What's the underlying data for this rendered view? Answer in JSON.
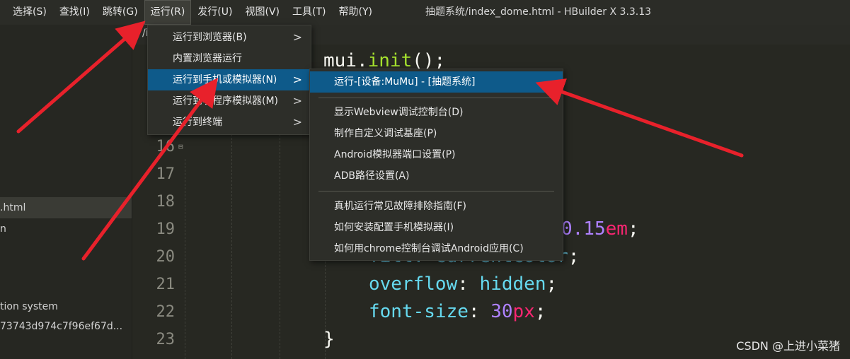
{
  "menubar": {
    "items": [
      "选择(S)",
      "查找(I)",
      "跳转(G)",
      "运行(R)",
      "发行(U)",
      "视图(V)",
      "工具(T)",
      "帮助(Y)"
    ],
    "title": "抽题系统/index_dome.html - HBuilder X 3.3.13"
  },
  "sidebar": {
    "files": [
      ".html",
      "n",
      "tion system",
      "73743d974c7f96ef67d..."
    ]
  },
  "editor": {
    "tab_fragment": "/i",
    "line_numbers": [
      "16",
      "17",
      "18",
      "19",
      "20",
      "21",
      "22",
      "23"
    ],
    "fold_marker": "⊟",
    "code": {
      "mui": "mui",
      "dot": ".",
      "init": "init",
      "init_tail": "();",
      "num_015": "0.15",
      "unit_em": "em",
      "semi": ";",
      "fill_fragment": "fill: currentColor",
      "overflow_prop": "overflow",
      "colon": ": ",
      "overflow_val": "hidden",
      "font_size_prop": "font-size",
      "font_size_num": "30",
      "font_size_unit": "px",
      "close_brace": "}"
    }
  },
  "run_menu": {
    "items": [
      {
        "label": "运行到浏览器(B)",
        "submenu": true
      },
      {
        "label": "内置浏览器运行",
        "submenu": false
      },
      {
        "label": "运行到手机或模拟器(N)",
        "submenu": true,
        "highlighted": true
      },
      {
        "label": "运行到小程序模拟器(M)",
        "submenu": true
      },
      {
        "label": "运行到终端",
        "submenu": true
      }
    ]
  },
  "device_submenu": {
    "items": [
      {
        "label": "运行-[设备:MuMu] - [抽题系统]",
        "highlighted": true
      },
      {
        "label": "显示Webview调试控制台(D)"
      },
      {
        "label": "制作自定义调试基座(P)"
      },
      {
        "label": "Android模拟器端口设置(P)"
      },
      {
        "label": "ADB路径设置(A)"
      },
      {
        "label": "真机运行常见故障排除指南(F)"
      },
      {
        "label": "如何安装配置手机模拟器(I)"
      },
      {
        "label": "如何用chrome控制台调试Android应用(C)"
      }
    ]
  },
  "chevron_glyph": ">",
  "watermark": "CSDN @上进小菜猪",
  "colors": {
    "highlight": "#0e5a8a",
    "arrow": "#e8212b",
    "editor_bg": "#272822"
  }
}
